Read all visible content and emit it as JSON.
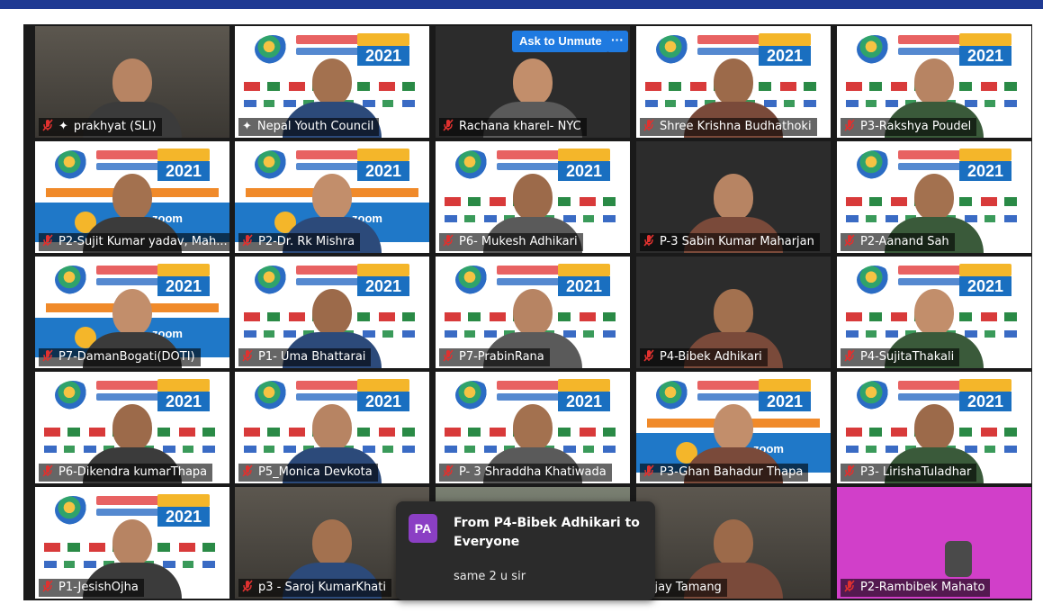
{
  "meeting": {
    "ask_to_unmute_label": "Ask to Unmute",
    "more_label": "···"
  },
  "banner": {
    "year": "2021",
    "zoom_text": "zoom"
  },
  "participants": [
    {
      "name": "prakhyat (SLI)",
      "muted": true,
      "pinned": true,
      "video": "room"
    },
    {
      "name": "Nepal Youth Council",
      "muted": false,
      "pinned": true,
      "video": "banner",
      "active_speaker": true
    },
    {
      "name": "Rachana kharel- NYC",
      "muted": true,
      "pinned": false,
      "video": "dark"
    },
    {
      "name": "Shree Krishna Budhathoki",
      "muted": true,
      "pinned": false,
      "video": "banner"
    },
    {
      "name": "P3-Rakshya Poudel",
      "muted": true,
      "pinned": false,
      "video": "banner"
    },
    {
      "name": "P2-Sujit Kumar yadav, Mah...",
      "muted": true,
      "pinned": false,
      "video": "banner-blue"
    },
    {
      "name": "P2-Dr. Rk Mishra",
      "muted": true,
      "pinned": false,
      "video": "banner-blue"
    },
    {
      "name": "P6- Mukesh Adhikari",
      "muted": true,
      "pinned": false,
      "video": "banner"
    },
    {
      "name": "P-3 Sabin Kumar Maharjan",
      "muted": true,
      "pinned": false,
      "video": "dark"
    },
    {
      "name": "P2-Aanand Sah",
      "muted": true,
      "pinned": false,
      "video": "banner"
    },
    {
      "name": "P7-DamanBogati(DOTI)",
      "muted": true,
      "pinned": false,
      "video": "banner-blue"
    },
    {
      "name": "P1- Uma Bhattarai",
      "muted": true,
      "pinned": false,
      "video": "banner"
    },
    {
      "name": "P7-PrabinRana",
      "muted": true,
      "pinned": false,
      "video": "banner"
    },
    {
      "name": "P4-Bibek Adhikari",
      "muted": true,
      "pinned": false,
      "video": "dark"
    },
    {
      "name": "P4-SujitaThakali",
      "muted": true,
      "pinned": false,
      "video": "banner"
    },
    {
      "name": "P6-Dikendra kumarThapa",
      "muted": true,
      "pinned": false,
      "video": "banner"
    },
    {
      "name": "P5_Monica Devkota",
      "muted": true,
      "pinned": false,
      "video": "banner"
    },
    {
      "name": "P- 3 Shraddha Khatiwada",
      "muted": true,
      "pinned": false,
      "video": "banner"
    },
    {
      "name": "P3-Ghan Bahadur Thapa",
      "muted": true,
      "pinned": false,
      "video": "banner-blue"
    },
    {
      "name": "P3- LirishaTuladhar",
      "muted": true,
      "pinned": false,
      "video": "banner"
    },
    {
      "name": "P1-JesishOjha",
      "muted": true,
      "pinned": false,
      "video": "banner"
    },
    {
      "name": "p3 - Saroj KumarKhati",
      "muted": true,
      "pinned": false,
      "video": "room"
    },
    {
      "name": "",
      "muted": false,
      "pinned": false,
      "video": "room2"
    },
    {
      "name": "Bijay Tamang",
      "muted": false,
      "pinned": false,
      "video": "room"
    },
    {
      "name": "P2-Rambibek Mahato",
      "muted": true,
      "pinned": false,
      "video": "pink"
    }
  ],
  "chat_popup": {
    "avatar_initials": "PA",
    "from_line": "From P4-Bibek Adhikari to Everyone",
    "message": "same 2 u sir"
  },
  "colors": {
    "accent_blue": "#1f7ae0",
    "active_speaker": "#e8f04a",
    "muted_icon": "#e0312f"
  }
}
